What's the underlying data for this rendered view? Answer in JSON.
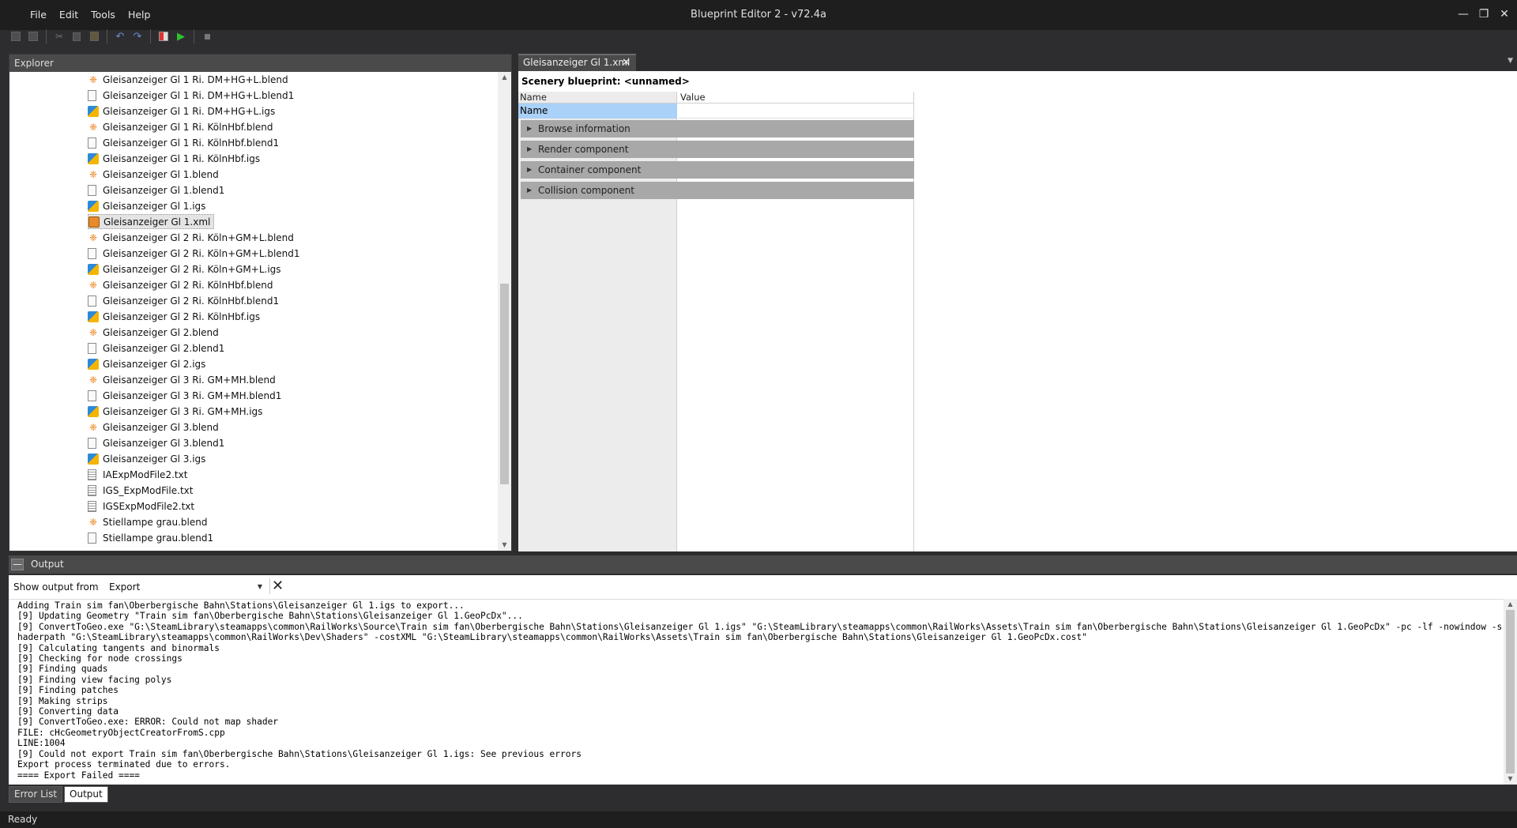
{
  "window": {
    "title": "Blueprint Editor 2 - v72.4a"
  },
  "menu": [
    {
      "label": "File"
    },
    {
      "label": "Edit"
    },
    {
      "label": "Tools"
    },
    {
      "label": "Help"
    }
  ],
  "toolbar": {
    "icons": [
      "save-icon",
      "save-all-icon",
      "cut-icon",
      "copy-icon",
      "paste-icon",
      "undo-icon",
      "redo-icon",
      "export-icon",
      "run-icon",
      "stop-icon"
    ]
  },
  "explorer": {
    "title": "Explorer",
    "items": [
      {
        "label": "Gleisanzeiger Gl 1 Ri. DM+HG+L.blend",
        "type": "blend"
      },
      {
        "label": "Gleisanzeiger Gl 1 Ri. DM+HG+L.blend1",
        "type": "file"
      },
      {
        "label": "Gleisanzeiger Gl 1 Ri. DM+HG+L.igs",
        "type": "igs"
      },
      {
        "label": "Gleisanzeiger Gl 1 Ri. KölnHbf.blend",
        "type": "blend"
      },
      {
        "label": "Gleisanzeiger Gl 1 Ri. KölnHbf.blend1",
        "type": "file"
      },
      {
        "label": "Gleisanzeiger Gl 1 Ri. KölnHbf.igs",
        "type": "igs"
      },
      {
        "label": "Gleisanzeiger Gl 1.blend",
        "type": "blend"
      },
      {
        "label": "Gleisanzeiger Gl 1.blend1",
        "type": "file"
      },
      {
        "label": "Gleisanzeiger Gl 1.igs",
        "type": "igs"
      },
      {
        "label": "Gleisanzeiger Gl 1.xml",
        "type": "xml",
        "selected": true
      },
      {
        "label": "Gleisanzeiger Gl 2 Ri. Köln+GM+L.blend",
        "type": "blend"
      },
      {
        "label": "Gleisanzeiger Gl 2 Ri. Köln+GM+L.blend1",
        "type": "file"
      },
      {
        "label": "Gleisanzeiger Gl 2 Ri. Köln+GM+L.igs",
        "type": "igs"
      },
      {
        "label": "Gleisanzeiger Gl 2 Ri. KölnHbf.blend",
        "type": "blend"
      },
      {
        "label": "Gleisanzeiger Gl 2 Ri. KölnHbf.blend1",
        "type": "file"
      },
      {
        "label": "Gleisanzeiger Gl 2 Ri. KölnHbf.igs",
        "type": "igs"
      },
      {
        "label": "Gleisanzeiger Gl 2.blend",
        "type": "blend"
      },
      {
        "label": "Gleisanzeiger Gl 2.blend1",
        "type": "file"
      },
      {
        "label": "Gleisanzeiger Gl 2.igs",
        "type": "igs"
      },
      {
        "label": "Gleisanzeiger Gl 3 Ri. GM+MH.blend",
        "type": "blend"
      },
      {
        "label": "Gleisanzeiger Gl 3 Ri. GM+MH.blend1",
        "type": "file"
      },
      {
        "label": "Gleisanzeiger Gl 3 Ri. GM+MH.igs",
        "type": "igs"
      },
      {
        "label": "Gleisanzeiger Gl 3.blend",
        "type": "blend"
      },
      {
        "label": "Gleisanzeiger Gl 3.blend1",
        "type": "file"
      },
      {
        "label": "Gleisanzeiger Gl 3.igs",
        "type": "igs"
      },
      {
        "label": "IAExpModFile2.txt",
        "type": "txt"
      },
      {
        "label": "IGS_ExpModFile.txt",
        "type": "txt"
      },
      {
        "label": "IGSExpModFile2.txt",
        "type": "txt"
      },
      {
        "label": "Stiellampe grau.blend",
        "type": "blend"
      },
      {
        "label": "Stiellampe grau.blend1",
        "type": "file"
      }
    ]
  },
  "editor": {
    "tab": {
      "label": "Gleisanzeiger Gl 1.xml"
    },
    "blueprint_title": "Scenery blueprint: <unnamed>",
    "grid": {
      "name_header": "Name",
      "value_header": "Value",
      "name_row_label": "Name",
      "name_row_value": ""
    },
    "sections": [
      {
        "label": "Browse information"
      },
      {
        "label": "Render component"
      },
      {
        "label": "Container component"
      },
      {
        "label": "Collision component"
      }
    ]
  },
  "output": {
    "title": "Output",
    "show_from_label": "Show output from:",
    "source": "Export",
    "lines": [
      "Adding Train sim fan\\Oberbergische Bahn\\Stations\\Gleisanzeiger Gl 1.igs to export...",
      "[9] Updating Geometry \"Train sim fan\\Oberbergische Bahn\\Stations\\Gleisanzeiger Gl 1.GeoPcDx\"...",
      "[9] ConvertToGeo.exe \"G:\\SteamLibrary\\steamapps\\common\\RailWorks\\Source\\Train sim fan\\Oberbergische Bahn\\Stations\\Gleisanzeiger Gl 1.igs\" \"G:\\SteamLibrary\\steamapps\\common\\RailWorks\\Assets\\Train sim fan\\Oberbergische Bahn\\Stations\\Gleisanzeiger Gl 1.GeoPcDx\" -pc -lf -nowindow -shaderpath \"G:\\SteamLibrary\\steamapps\\common\\RailWorks\\Dev\\Shaders\" -costXML \"G:\\SteamLibrary\\steamapps\\common\\RailWorks\\Assets\\Train sim fan\\Oberbergische Bahn\\Stations\\Gleisanzeiger Gl 1.GeoPcDx.cost\"",
      "[9] Calculating tangents and binormals",
      "[9] Checking for node crossings",
      "[9] Finding quads",
      "[9] Finding view facing polys",
      "[9] Finding patches",
      "[9] Making strips",
      "[9] Converting data",
      "[9] ConvertToGeo.exe: ERROR: Could not map shader",
      "FILE: cHcGeometryObjectCreatorFromS.cpp",
      "LINE:1004",
      "[9] Could not export Train sim fan\\Oberbergische Bahn\\Stations\\Gleisanzeiger Gl 1.igs: See previous errors",
      "Export process terminated due to errors.",
      "==== Export Failed ===="
    ]
  },
  "bottom_tabs": [
    {
      "label": "Error List"
    },
    {
      "label": "Output",
      "active": true
    }
  ],
  "status": {
    "text": "Ready"
  }
}
